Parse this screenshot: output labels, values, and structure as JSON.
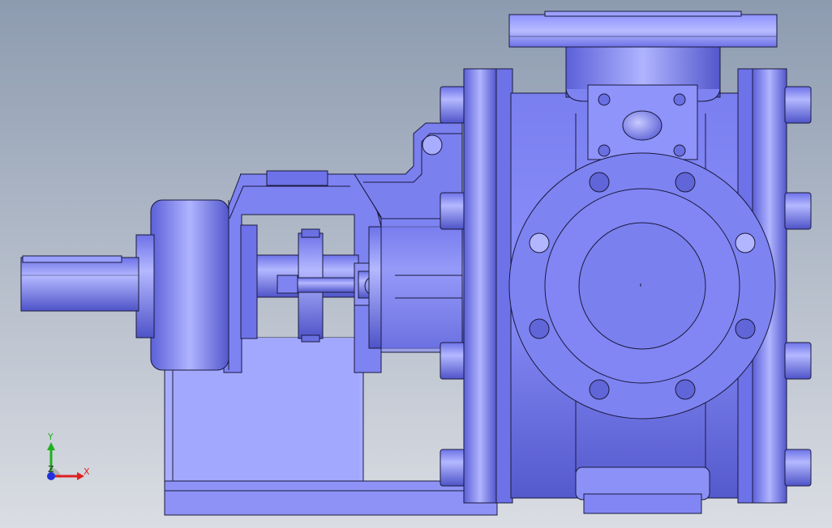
{
  "viewport": {
    "background_top": "#8d9bb0",
    "background_bottom": "#dadde3",
    "part_fill_light": "#a8adff",
    "part_fill_mid": "#7f84f0",
    "part_fill_dark": "#5a5fd6",
    "edge_color": "#1a1a3c"
  },
  "triad": {
    "x_label": "X",
    "y_label": "Y",
    "z_label": "Z",
    "x_color": "#e02020",
    "y_color": "#20b020",
    "z_color": "#2030e0"
  }
}
